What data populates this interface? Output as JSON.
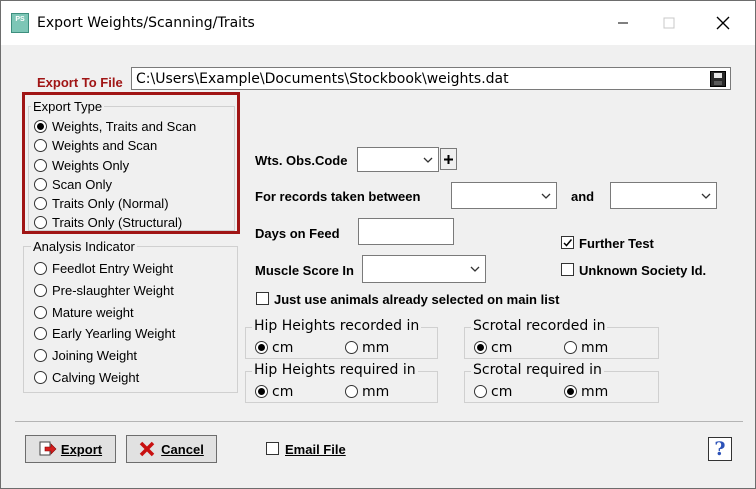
{
  "window": {
    "title": "Export Weights/Scanning/Traits",
    "app_icon_text": "PS"
  },
  "export_to_file": {
    "label": "Export To File",
    "path": "C:\\Users\\Example\\Documents\\Stockbook\\weights.dat"
  },
  "export_type": {
    "title": "Export Type",
    "options": [
      "Weights, Traits and Scan",
      "Weights and Scan",
      "Weights Only",
      "Scan Only",
      "Traits Only (Normal)",
      "Traits Only (Structural)"
    ],
    "selected_index": 0
  },
  "analysis_indicator": {
    "title": "Analysis Indicator",
    "options": [
      "Feedlot Entry Weight",
      "Pre-slaughter Weight",
      "Mature weight",
      "Early Yearling Weight",
      "Joining Weight",
      "Calving Weight"
    ]
  },
  "fields": {
    "wts_obs_code": "Wts. Obs.Code",
    "records_between": "For records taken between",
    "and": "and",
    "days_on_feed": "Days on Feed",
    "muscle_score": "Muscle Score In",
    "just_use_selected": "Just use animals already selected on main list",
    "further_test": "Further Test",
    "unknown_society": "Unknown Society Id."
  },
  "units": {
    "hip_recorded": {
      "title": "Hip Heights recorded in",
      "options": [
        "cm",
        "mm"
      ],
      "selected": "cm"
    },
    "scrotal_recorded": {
      "title": "Scrotal recorded in",
      "options": [
        "cm",
        "mm"
      ],
      "selected": "cm"
    },
    "hip_required": {
      "title": "Hip Heights required in",
      "options": [
        "cm",
        "mm"
      ],
      "selected": "cm"
    },
    "scrotal_required": {
      "title": "Scrotal required in",
      "options": [
        "cm",
        "mm"
      ],
      "selected": "mm"
    }
  },
  "buttons": {
    "export": "Export",
    "cancel": "Cancel",
    "email_file": "Email File",
    "help": "?"
  },
  "colors": {
    "highlight_border": "#a01515",
    "label_red": "#a01515"
  }
}
